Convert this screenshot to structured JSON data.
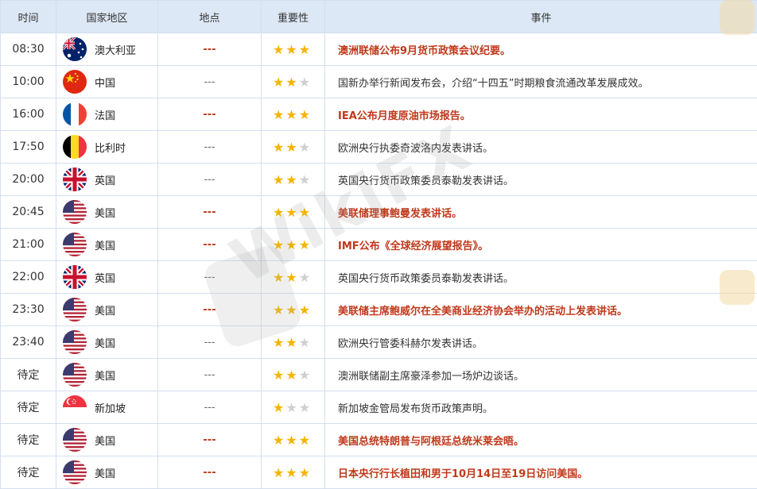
{
  "header": {
    "time": "时间",
    "country": "国家地区",
    "location": "地点",
    "importance": "重要性",
    "event": "事件"
  },
  "watermark": "WikiFX",
  "rows": [
    {
      "time": "08:30",
      "country": "澳大利亚",
      "flag": "australia-flag-icon",
      "location": "---",
      "stars": 3,
      "event": "澳洲联储公布9月货币政策会议纪要。",
      "highlight": true
    },
    {
      "time": "10:00",
      "country": "中国",
      "flag": "china-flag-icon",
      "location": "---",
      "stars": 2,
      "event": "国新办举行新闻发布会，介绍“十四五”时期粮食流通改革发展成效。",
      "highlight": false
    },
    {
      "time": "16:00",
      "country": "法国",
      "flag": "france-flag-icon",
      "location": "---",
      "stars": 3,
      "event": "IEA公布月度原油市场报告。",
      "highlight": true
    },
    {
      "time": "17:50",
      "country": "比利时",
      "flag": "belgium-flag-icon",
      "location": "---",
      "stars": 2,
      "event": "欧洲央行执委奇波洛内发表讲话。",
      "highlight": false
    },
    {
      "time": "20:00",
      "country": "英国",
      "flag": "uk-flag-icon",
      "location": "---",
      "stars": 2,
      "event": "英国央行货币政策委员泰勒发表讲话。",
      "highlight": false
    },
    {
      "time": "20:45",
      "country": "美国",
      "flag": "us-flag-icon",
      "location": "---",
      "stars": 3,
      "event": "美联储理事鲍曼发表讲话。",
      "highlight": true
    },
    {
      "time": "21:00",
      "country": "美国",
      "flag": "us-flag-icon",
      "location": "---",
      "stars": 3,
      "event": "IMF公布《全球经济展望报告》。",
      "highlight": true
    },
    {
      "time": "22:00",
      "country": "英国",
      "flag": "uk-flag-icon",
      "location": "---",
      "stars": 2,
      "event": "英国央行货币政策委员泰勒发表讲话。",
      "highlight": false
    },
    {
      "time": "23:30",
      "country": "美国",
      "flag": "us-flag-icon",
      "location": "---",
      "stars": 3,
      "event": "美联储主席鲍威尔在全美商业经济协会举办的活动上发表讲话。",
      "highlight": true
    },
    {
      "time": "23:40",
      "country": "美国",
      "flag": "us-flag-icon",
      "location": "---",
      "stars": 2,
      "event": "欧洲央行管委科赫尔发表讲话。",
      "highlight": false
    },
    {
      "time": "待定",
      "country": "美国",
      "flag": "us-flag-icon",
      "location": "---",
      "stars": 2,
      "event": "澳洲联储副主席豪泽参加一场炉边谈话。",
      "highlight": false
    },
    {
      "time": "待定",
      "country": "新加坡",
      "flag": "singapore-flag-icon",
      "location": "---",
      "stars": 1,
      "event": "新加坡金管局发布货币政策声明。",
      "highlight": false
    },
    {
      "time": "待定",
      "country": "美国",
      "flag": "us-flag-icon",
      "location": "---",
      "stars": 3,
      "event": "美国总统特朗普与阿根廷总统米莱会晤。",
      "highlight": true
    },
    {
      "time": "待定",
      "country": "美国",
      "flag": "us-flag-icon",
      "location": "---",
      "stars": 3,
      "event": "日本央行行长植田和男于10月14日至19日访问美国。",
      "highlight": true
    }
  ]
}
